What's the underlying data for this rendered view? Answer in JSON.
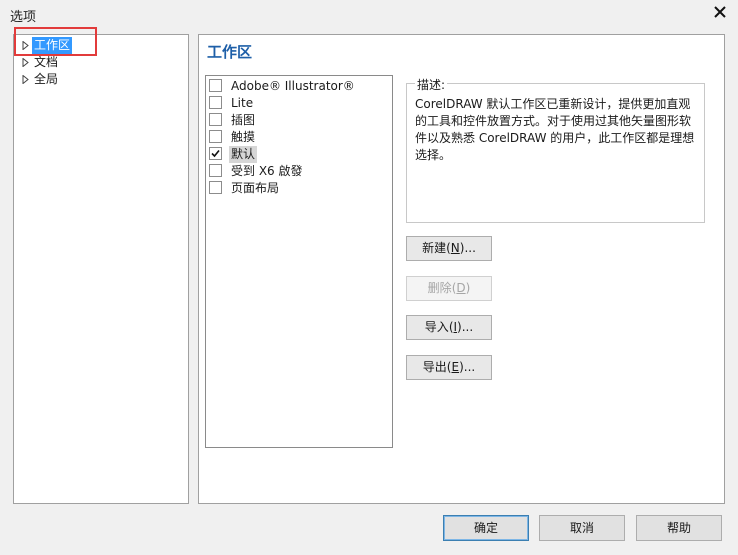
{
  "window": {
    "title": "选项"
  },
  "tree": {
    "items": [
      {
        "label": "工作区",
        "selected": true
      },
      {
        "label": "文档",
        "selected": false
      },
      {
        "label": "全局",
        "selected": false
      }
    ]
  },
  "panel": {
    "title": "工作区",
    "workspaces": [
      {
        "label": "Adobe® Illustrator®",
        "checked": false
      },
      {
        "label": "Lite",
        "checked": false
      },
      {
        "label": "插图",
        "checked": false
      },
      {
        "label": "触摸",
        "checked": false
      },
      {
        "label": "默认",
        "checked": true
      },
      {
        "label": "受到 X6 啟發",
        "checked": false
      },
      {
        "label": "页面布局",
        "checked": false
      }
    ],
    "description": {
      "label": "描述:",
      "text": "CorelDRAW 默认工作区已重新设计，提供更加直观的工具和控件放置方式。对于使用过其他矢量图形软件以及熟悉 CorelDRAW 的用户，此工作区都是理想选择。"
    },
    "buttons": {
      "new": {
        "text": "新建",
        "key": "N",
        "suffix": "..."
      },
      "delete": {
        "text": "删除",
        "key": "D",
        "suffix": ""
      },
      "import": {
        "text": "导入",
        "key": "I",
        "suffix": "..."
      },
      "export": {
        "text": "导出",
        "key": "E",
        "suffix": "..."
      }
    }
  },
  "footer": {
    "ok": "确定",
    "cancel": "取消",
    "help": "帮助"
  },
  "colors": {
    "accent": "#1e5fa8",
    "selection": "#3399ff",
    "highlight_box": "#e23b3b"
  }
}
